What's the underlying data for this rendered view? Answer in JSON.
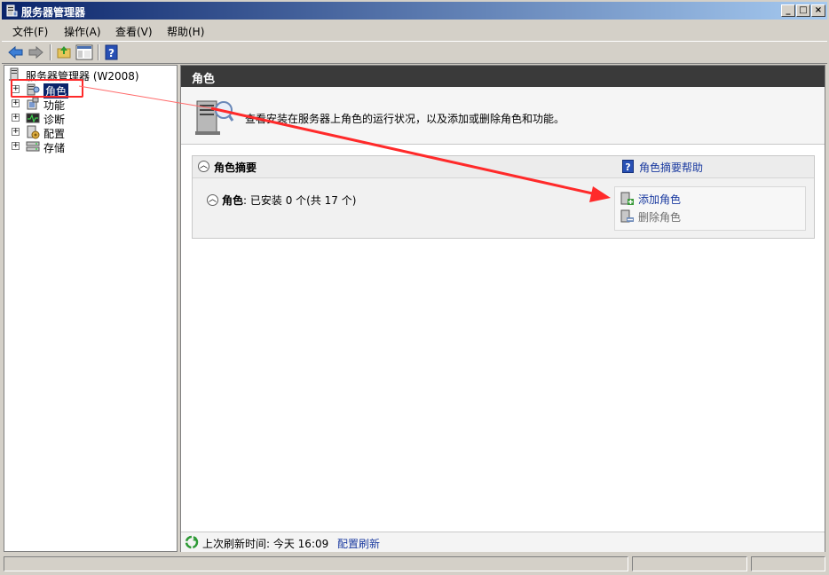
{
  "window": {
    "title": "服务器管理器",
    "controls": [
      "minimize",
      "maximize",
      "close"
    ]
  },
  "menu": {
    "items": [
      {
        "label": "文件(F)"
      },
      {
        "label": "操作(A)"
      },
      {
        "label": "查看(V)"
      },
      {
        "label": "帮助(H)"
      }
    ]
  },
  "toolbar": {
    "buttons": [
      "back-icon",
      "forward-icon",
      "up-folder-icon",
      "show-hide-tree-icon",
      "help-icon"
    ]
  },
  "tree": {
    "root": {
      "label": "服务器管理器 (W2008)",
      "icon": "server-manager-icon"
    },
    "items": [
      {
        "label": "角色",
        "icon": "roles-icon",
        "selected": true
      },
      {
        "label": "功能",
        "icon": "features-icon"
      },
      {
        "label": "诊断",
        "icon": "diagnostics-icon"
      },
      {
        "label": "配置",
        "icon": "configuration-icon"
      },
      {
        "label": "存储",
        "icon": "storage-icon"
      }
    ]
  },
  "main": {
    "header": "角色",
    "intro_text": "查看安装在服务器上角色的运行状况，以及添加或删除角色和功能。",
    "summary": {
      "title": "角色摘要",
      "help_link": "角色摘要帮助",
      "roles_label": "角色",
      "roles_status": ": 已安装 0 个(共 17 个)",
      "actions": [
        {
          "label": "添加角色",
          "icon": "add-role-icon",
          "enabled": true
        },
        {
          "label": "删除角色",
          "icon": "remove-role-icon",
          "enabled": false
        }
      ]
    },
    "refresh": {
      "text": "上次刷新时间: 今天 16:09",
      "link": "配置刷新"
    }
  },
  "colors": {
    "title_bar": "#0a246a",
    "link": "#1a3aa0",
    "annotation": "#ff2a2a",
    "selection": "#0a246a"
  }
}
